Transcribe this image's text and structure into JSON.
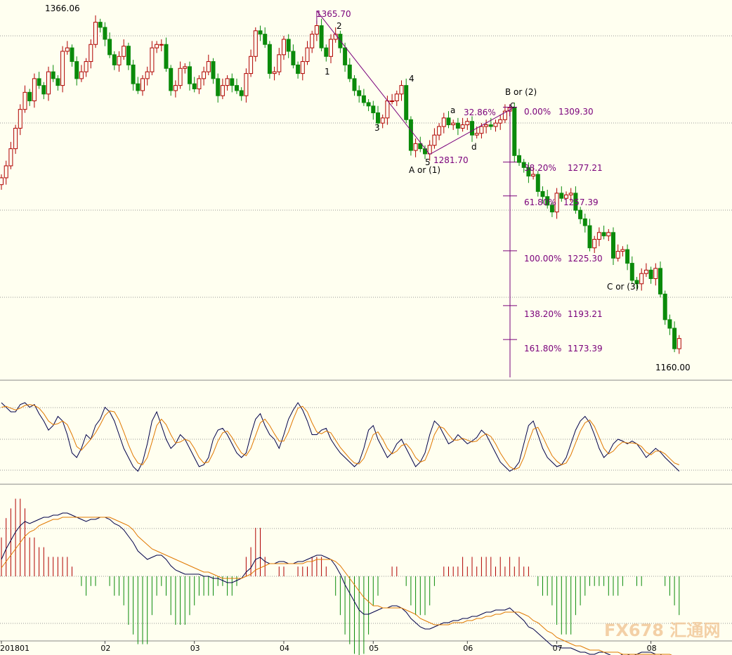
{
  "chart_data": [
    {
      "type": "candlestick",
      "panel": "price",
      "grid": true,
      "ylim": [
        1150,
        1372
      ],
      "xlim": [
        0,
        150
      ],
      "colors": {
        "up": "#b00000",
        "down": "#0a8a0a",
        "fib": "#7a007a",
        "wave": "#000000",
        "grid": "#999999",
        "bg": "#fffff0"
      },
      "x_ticks": [
        {
          "x": 0,
          "label": "201801"
        },
        {
          "x": 22,
          "label": "02"
        },
        {
          "x": 41,
          "label": "03"
        },
        {
          "x": 60,
          "label": "04"
        },
        {
          "x": 79,
          "label": "05"
        },
        {
          "x": 99,
          "label": "06"
        },
        {
          "x": 118,
          "label": "07"
        },
        {
          "x": 138,
          "label": "08"
        }
      ],
      "closes": [
        1268,
        1275,
        1285,
        1297,
        1308,
        1318,
        1313,
        1326,
        1322,
        1317,
        1330,
        1326,
        1322,
        1342,
        1344,
        1336,
        1326,
        1330,
        1336,
        1346,
        1359,
        1356,
        1349,
        1340,
        1334,
        1339,
        1345,
        1334,
        1323,
        1319,
        1326,
        1330,
        1344,
        1346,
        1346,
        1332,
        1319,
        1322,
        1332,
        1333,
        1323,
        1320,
        1326,
        1330,
        1336,
        1326,
        1316,
        1322,
        1326,
        1322,
        1319,
        1316,
        1329,
        1339,
        1354,
        1352,
        1346,
        1329,
        1330,
        1340,
        1349,
        1342,
        1334,
        1329,
        1336,
        1344,
        1352,
        1357,
        1344,
        1339,
        1349,
        1352,
        1344,
        1334,
        1326,
        1319,
        1316,
        1312,
        1310,
        1306,
        1300,
        1303,
        1313,
        1313,
        1317,
        1322,
        1302,
        1284,
        1288,
        1285,
        1282,
        1287,
        1293,
        1298,
        1303,
        1299,
        1300,
        1297,
        1299,
        1301,
        1293,
        1294,
        1298,
        1299,
        1298,
        1300,
        1302,
        1307,
        1309,
        1281,
        1277,
        1274,
        1269,
        1270,
        1260,
        1257,
        1252,
        1248,
        1259,
        1256,
        1258,
        1259,
        1249,
        1244,
        1240,
        1227,
        1232,
        1236,
        1234,
        1236,
        1221,
        1225,
        1226,
        1218,
        1208,
        1206,
        1212,
        1214,
        1209,
        1215,
        1200,
        1185,
        1180,
        1168,
        1174
      ]
    },
    {
      "type": "line",
      "panel": "stochastic",
      "series": [
        {
          "name": "",
          "color": "#00004a",
          "values": [
            90,
            85,
            80,
            80,
            88,
            90,
            85,
            88,
            78,
            70,
            60,
            65,
            75,
            70,
            55,
            35,
            30,
            40,
            55,
            50,
            65,
            72,
            85,
            80,
            70,
            55,
            40,
            30,
            20,
            15,
            25,
            45,
            70,
            80,
            65,
            50,
            40,
            45,
            55,
            50,
            40,
            30,
            20,
            22,
            30,
            50,
            60,
            62,
            55,
            45,
            35,
            30,
            35,
            55,
            72,
            78,
            65,
            55,
            50,
            40,
            55,
            72,
            82,
            90,
            82,
            70,
            55,
            55,
            60,
            62,
            50,
            42,
            35,
            30,
            25,
            20,
            25,
            40,
            60,
            65,
            50,
            40,
            30,
            35,
            45,
            50,
            40,
            30,
            20,
            25,
            35,
            55,
            70,
            65,
            55,
            45,
            48,
            55,
            50,
            45,
            48,
            52,
            60,
            55,
            45,
            35,
            25,
            20,
            15,
            18,
            25,
            45,
            65,
            70,
            55,
            40,
            30,
            25,
            20,
            22,
            30,
            45,
            60,
            70,
            75,
            68,
            55,
            40,
            30,
            35,
            45,
            50,
            48,
            45,
            48,
            45,
            38,
            30,
            35,
            40,
            36,
            30,
            25,
            20,
            15
          ]
        },
        {
          "name": "",
          "color": "#e07800",
          "values": [
            85,
            86,
            84,
            82,
            84,
            87,
            88,
            87,
            84,
            78,
            70,
            66,
            67,
            70,
            66,
            55,
            42,
            38,
            44,
            50,
            57,
            66,
            76,
            81,
            80,
            71,
            58,
            44,
            32,
            24,
            22,
            30,
            47,
            65,
            72,
            66,
            55,
            46,
            47,
            50,
            48,
            40,
            30,
            24,
            25,
            35,
            48,
            57,
            59,
            52,
            43,
            35,
            32,
            40,
            54,
            68,
            72,
            65,
            56,
            48,
            48,
            58,
            72,
            84,
            86,
            80,
            68,
            58,
            56,
            59,
            57,
            49,
            41,
            35,
            29,
            24,
            23,
            29,
            42,
            55,
            58,
            50,
            40,
            34,
            37,
            43,
            45,
            39,
            30,
            25,
            27,
            39,
            55,
            64,
            62,
            55,
            49,
            49,
            51,
            49,
            47,
            48,
            53,
            56,
            53,
            45,
            35,
            27,
            20,
            17,
            19,
            30,
            47,
            61,
            63,
            53,
            42,
            32,
            26,
            22,
            24,
            33,
            46,
            59,
            68,
            71,
            64,
            52,
            40,
            34,
            37,
            43,
            47,
            46,
            46,
            45,
            42,
            36,
            33,
            37,
            37,
            34,
            29,
            24,
            22
          ]
        }
      ]
    },
    {
      "type": "line",
      "panel": "macd",
      "series": [
        {
          "name": "",
          "color": "#00004a",
          "values": [
            8,
            13,
            17,
            21,
            24,
            26,
            25,
            26,
            27,
            28,
            28,
            29,
            29,
            30,
            30,
            29,
            28,
            27,
            26,
            27,
            27,
            28,
            28,
            27,
            25,
            24,
            22,
            19,
            16,
            12,
            10,
            8,
            9,
            10,
            10,
            8,
            5,
            3,
            2,
            1,
            1,
            1,
            1,
            0,
            0,
            -1,
            -1,
            -2,
            -3,
            -3,
            -2,
            -1,
            2,
            4,
            8,
            9,
            7,
            6,
            6,
            7,
            7,
            6,
            6,
            7,
            7,
            8,
            9,
            10,
            10,
            9,
            8,
            5,
            1,
            -4,
            -8,
            -12,
            -16,
            -18,
            -18,
            -17,
            -16,
            -15,
            -15,
            -14,
            -14,
            -15,
            -17,
            -20,
            -22,
            -24,
            -25,
            -25,
            -24,
            -23,
            -22,
            -22,
            -21,
            -21,
            -20,
            -20,
            -19,
            -19,
            -18,
            -17,
            -17,
            -16,
            -16,
            -16,
            -15,
            -17,
            -19,
            -21,
            -24,
            -25,
            -27,
            -29,
            -31,
            -33,
            -33,
            -34,
            -34,
            -34,
            -35,
            -36,
            -36,
            -37,
            -37,
            -36,
            -36,
            -37,
            -38,
            -38,
            -37,
            -37,
            -38,
            -37,
            -36,
            -36,
            -36,
            -37,
            -37,
            -39,
            -41,
            -42,
            -43
          ]
        },
        {
          "name": "",
          "color": "#e07800",
          "values": [
            4,
            7,
            10,
            13,
            16,
            19,
            21,
            22,
            24,
            25,
            26,
            27,
            27,
            28,
            28,
            28,
            28,
            28,
            28,
            28,
            28,
            28,
            28,
            28,
            27,
            26,
            25,
            24,
            22,
            19,
            17,
            15,
            13,
            12,
            11,
            10,
            9,
            8,
            7,
            6,
            5,
            4,
            3,
            2,
            2,
            1,
            0,
            -1,
            -1,
            -1,
            -1,
            -1,
            0,
            1,
            3,
            4,
            5,
            6,
            6,
            6,
            6,
            6,
            6,
            6,
            6,
            7,
            7,
            8,
            8,
            8,
            8,
            7,
            5,
            2,
            -1,
            -4,
            -7,
            -10,
            -12,
            -14,
            -14,
            -15,
            -15,
            -15,
            -15,
            -15,
            -16,
            -17,
            -18,
            -20,
            -21,
            -22,
            -23,
            -23,
            -23,
            -23,
            -22,
            -22,
            -22,
            -21,
            -21,
            -20,
            -20,
            -19,
            -19,
            -18,
            -18,
            -17,
            -17,
            -17,
            -17,
            -18,
            -19,
            -21,
            -22,
            -24,
            -26,
            -27,
            -29,
            -30,
            -31,
            -32,
            -33,
            -33,
            -34,
            -35,
            -35,
            -35,
            -36,
            -36,
            -36,
            -36,
            -37,
            -37,
            -37,
            -37,
            -37,
            -37,
            -37,
            -37,
            -37,
            -37,
            -37,
            -38,
            -38,
            -39,
            -40
          ]
        },
        {
          "name": "",
          "color": "#b00000",
          "values": [
            8,
            12,
            14,
            16,
            16,
            14,
            8,
            8,
            6,
            6,
            4,
            4,
            4,
            4,
            4,
            2,
            0,
            -2,
            -4,
            -2,
            -2,
            0,
            0,
            -2,
            -4,
            -4,
            -6,
            -10,
            -12,
            -14,
            -14,
            -14,
            -8,
            -4,
            -2,
            -4,
            -8,
            -10,
            -10,
            -10,
            -8,
            -6,
            -4,
            -4,
            -4,
            -4,
            -2,
            -2,
            -4,
            -4,
            -2,
            0,
            4,
            6,
            10,
            10,
            4,
            0,
            0,
            2,
            2,
            0,
            0,
            2,
            2,
            2,
            4,
            4,
            4,
            2,
            0,
            -4,
            -8,
            -12,
            -14,
            -16,
            -18,
            -16,
            -12,
            -6,
            -4,
            0,
            0,
            2,
            2,
            0,
            -2,
            -6,
            -8,
            -8,
            -8,
            -6,
            -2,
            0,
            2,
            2,
            2,
            2,
            4,
            2,
            4,
            2,
            4,
            4,
            4,
            2,
            4,
            2,
            4,
            2,
            4,
            2,
            2,
            0,
            -2,
            -4,
            -4,
            -6,
            -10,
            -12,
            -12,
            -12,
            -8,
            -6,
            -4,
            -2,
            -2,
            -2,
            -2,
            -4,
            -4,
            -4,
            -2,
            0,
            0,
            -2,
            -2,
            0,
            0,
            0,
            0,
            -2,
            -4,
            -6,
            -8
          ]
        }
      ]
    }
  ],
  "labels": {
    "high_top": "1366.06",
    "peak": "1365.70",
    "w1": "1",
    "w2": "2",
    "w3": "3",
    "w4": "4",
    "w5": "5",
    "low1": "1281.70",
    "a_or_1": "A or (1)",
    "b_or_2": "B or (2)",
    "pct_3286": "32.86%",
    "wa": "a",
    "wc": "c",
    "wd": "d",
    "c_or_3": "C or (3)",
    "low_final": "1160.00"
  },
  "fib_levels": [
    {
      "pct": "0.00%",
      "value": "1309.30",
      "price": 1309.3
    },
    {
      "pct": "38.20%",
      "value": "1277.21",
      "price": 1277.21
    },
    {
      "pct": "61.80%",
      "value": "1257.39",
      "price": 1257.39
    },
    {
      "pct": "100.00%",
      "value": "1225.30",
      "price": 1225.3
    },
    {
      "pct": "138.20%",
      "value": "1193.21",
      "price": 1193.21
    },
    {
      "pct": "161.80%",
      "value": "1173.39",
      "price": 1173.39
    }
  ],
  "watermark": "FX678 汇通网"
}
